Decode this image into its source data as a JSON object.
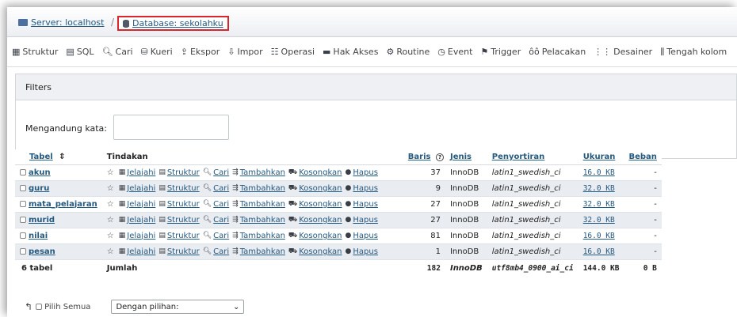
{
  "breadcrumb": {
    "server_label": "Server: localhost",
    "separator": "/",
    "database_label": "Database: sekolahku"
  },
  "menu": [
    {
      "label": "Struktur",
      "icon": "table-structure-icon",
      "glyph": "▦"
    },
    {
      "label": "SQL",
      "icon": "sql-icon",
      "glyph": "▤"
    },
    {
      "label": "Cari",
      "icon": "search-icon",
      "glyph": "🔍︎"
    },
    {
      "label": "Kueri",
      "icon": "query-db-icon",
      "glyph": "⛁"
    },
    {
      "label": "Ekspor",
      "icon": "export-icon",
      "glyph": "⇪"
    },
    {
      "label": "Impor",
      "icon": "import-icon",
      "glyph": "⇩"
    },
    {
      "label": "Operasi",
      "icon": "operations-icon",
      "glyph": "☷"
    },
    {
      "label": "Hak Akses",
      "icon": "privileges-icon",
      "glyph": "▬"
    },
    {
      "label": "Routine",
      "icon": "routine-icon",
      "glyph": "⚙"
    },
    {
      "label": "Event",
      "icon": "clock-icon",
      "glyph": "◷"
    },
    {
      "label": "Trigger",
      "icon": "trigger-icon",
      "glyph": "⚑"
    },
    {
      "label": "Pelacakan",
      "icon": "tracking-icon",
      "glyph": "ôô"
    },
    {
      "label": "Desainer",
      "icon": "designer-icon",
      "glyph": "⋮⋮"
    },
    {
      "label": "Tengah kolom",
      "icon": "central-columns-icon",
      "glyph": "⫼"
    }
  ],
  "filters": {
    "heading": "Filters",
    "label": "Mengandung kata:",
    "value": ""
  },
  "table": {
    "headers": {
      "tabel": "Tabel",
      "sort_icon": "⇕",
      "tindakan": "Tindakan",
      "baris": "Baris",
      "help_icon": "?",
      "jenis": "Jenis",
      "penyortiran": "Penyortiran",
      "ukuran": "Ukuran",
      "beban": "Beban"
    },
    "actions": [
      "Jelajahi",
      "Struktur",
      "Cari",
      "Tambahkan",
      "Kosongkan",
      "Hapus"
    ],
    "rows": [
      {
        "name": "akun",
        "rows": "37",
        "engine": "InnoDB",
        "collation": "latin1_swedish_ci",
        "size": "16.0 KB",
        "overhead": "-"
      },
      {
        "name": "guru",
        "rows": "9",
        "engine": "InnoDB",
        "collation": "latin1_swedish_ci",
        "size": "32.0 KB",
        "overhead": "-"
      },
      {
        "name": "mata_pelajaran",
        "rows": "27",
        "engine": "InnoDB",
        "collation": "latin1_swedish_ci",
        "size": "32.0 KB",
        "overhead": "-"
      },
      {
        "name": "murid",
        "rows": "27",
        "engine": "InnoDB",
        "collation": "latin1_swedish_ci",
        "size": "32.0 KB",
        "overhead": "-"
      },
      {
        "name": "nilai",
        "rows": "81",
        "engine": "InnoDB",
        "collation": "latin1_swedish_ci",
        "size": "16.0 KB",
        "overhead": "-"
      },
      {
        "name": "pesan",
        "rows": "1",
        "engine": "InnoDB",
        "collation": "latin1_swedish_ci",
        "size": "16.0 KB",
        "overhead": "-"
      }
    ],
    "footer": {
      "count": "6 tabel",
      "label": "Jumlah",
      "rows": "182",
      "engine": "InnoDB",
      "collation": "utf8mb4_0900_ai_ci",
      "size": "144.0 KB",
      "overhead": "0 B"
    }
  },
  "bulk": {
    "select_all": "Pilih Semua",
    "with_selected": "Dengan pilihan:"
  }
}
